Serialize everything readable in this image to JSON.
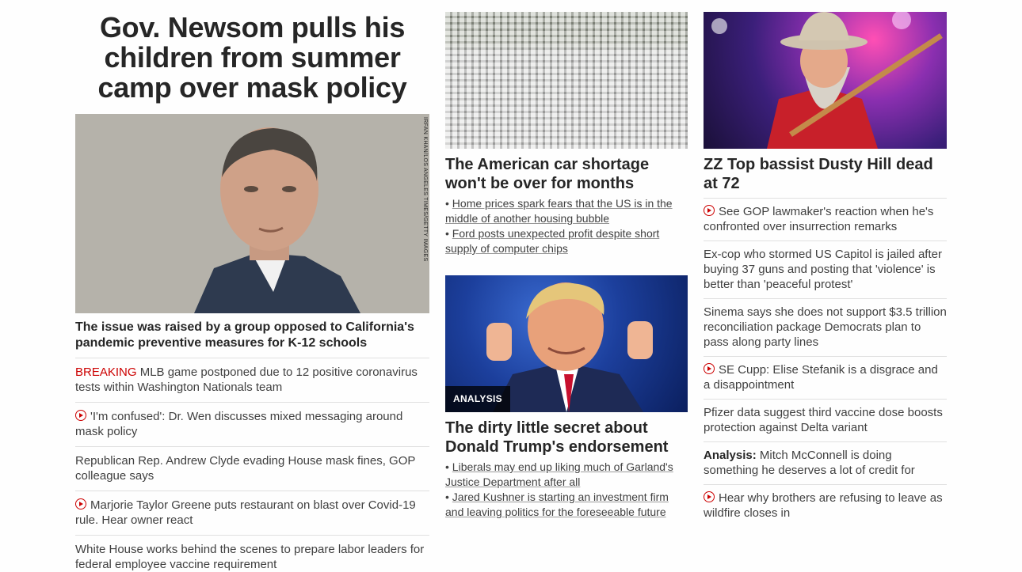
{
  "left": {
    "headline": "Gov. Newsom pulls his children from summer camp over mask policy",
    "photo_credit": "IRFAN KHAN/LOS ANGELES TIMES/GETTY IMAGES",
    "subhead": "The issue was raised by a group opposed to California's pandemic preventive measures for K-12 schools",
    "items": [
      {
        "prefix": "BREAKING",
        "text": " MLB game postponed due to 12 positive coronavirus tests within Washington Nationals team"
      },
      {
        "text": "'I'm confused': Dr. Wen discusses mixed messaging around mask policy"
      },
      {
        "text": "Republican Rep. Andrew Clyde evading House mask fines, GOP colleague says"
      },
      {
        "text": "Marjorie Taylor Greene puts restaurant on blast over Covid-19 rule. Hear owner react"
      },
      {
        "text": "White House works behind the scenes to prepare labor leaders for federal employee vaccine requirement"
      }
    ]
  },
  "middle": {
    "story1": {
      "headline": "The American car shortage won't be over for months",
      "bullets": [
        "Home prices spark fears that the US is in the middle of another housing bubble",
        "Ford posts unexpected profit despite short supply of computer chips"
      ]
    },
    "story2": {
      "tag": "ANALYSIS",
      "headline": "The dirty little secret about Donald Trump's endorsement",
      "bullets": [
        "Liberals may end up liking much of Garland's Justice Department after all",
        "Jared Kushner is starting an investment firm and leaving politics for the foreseeable future"
      ]
    }
  },
  "right": {
    "headline": "ZZ Top bassist Dusty Hill dead at 72",
    "items": [
      {
        "text": "See GOP lawmaker's reaction when he's confronted over insurrection remarks"
      },
      {
        "text": "Ex-cop who stormed US Capitol is jailed after buying 37 guns and posting that 'violence' is better than 'peaceful protest'"
      },
      {
        "text": "Sinema says she does not support $3.5 trillion reconciliation package Democrats plan to pass along party lines"
      },
      {
        "text": "SE Cupp: Elise Stefanik is a disgrace and a disappointment"
      },
      {
        "text": "Pfizer data suggest third vaccine dose boosts protection against Delta variant"
      },
      {
        "label": "Analysis:",
        "text": " Mitch McConnell is doing something he deserves a lot of credit for"
      },
      {
        "text": "Hear why brothers are refusing to leave as wildfire closes in"
      }
    ]
  },
  "colors": {
    "breaking": "#cc0000",
    "text": "#262626",
    "divider": "#e0e0e0"
  }
}
